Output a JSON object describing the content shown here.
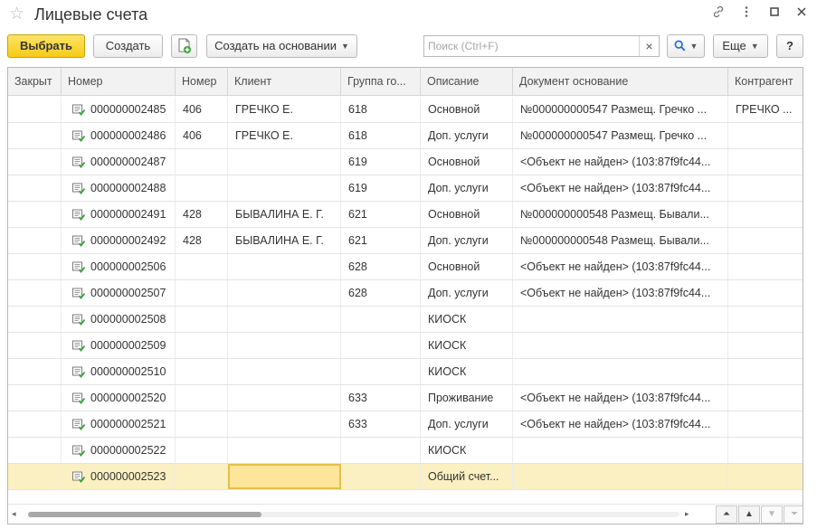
{
  "window": {
    "title": "Лицевые счета",
    "link_icon": "link-icon",
    "more_icon": "more-vertical-icon",
    "maximize_icon": "maximize-icon",
    "close_icon": "close-icon"
  },
  "toolbar": {
    "select_label": "Выбрать",
    "create_label": "Создать",
    "copy_icon": "copy-add-icon",
    "create_based_label": "Создать на основании",
    "search_placeholder": "Поиск (Ctrl+F)",
    "search_value": "",
    "clear_glyph": "×",
    "search_icon_glyph": "🔍",
    "more_label": "Еще",
    "help_label": "?"
  },
  "colors": {
    "primary_button": "#f5cc14",
    "selected_row": "#fbf0c2",
    "active_cell": "#fde59a",
    "icon_green": "#3aa33a"
  },
  "table": {
    "columns": [
      "Закрыт",
      "Номер",
      "Номер",
      "Клиент",
      "Группа го...",
      "Описание",
      "Документ основание",
      "Контрагент"
    ],
    "rows": [
      {
        "closed": "",
        "number": "000000002485",
        "num2": "406",
        "client": "ГРЕЧКО Е.",
        "group": "618",
        "description": "Основной",
        "document": "№000000000547 Размещ. Гречко ...",
        "counterparty": "ГРЕЧКО ..."
      },
      {
        "closed": "",
        "number": "000000002486",
        "num2": "406",
        "client": "ГРЕЧКО Е.",
        "group": "618",
        "description": "Доп. услуги",
        "document": "№000000000547 Размещ. Гречко ...",
        "counterparty": ""
      },
      {
        "closed": "",
        "number": "000000002487",
        "num2": "",
        "client": "",
        "group": "619",
        "description": "Основной",
        "document": "<Объект не найден> (103:87f9fc44...",
        "counterparty": ""
      },
      {
        "closed": "",
        "number": "000000002488",
        "num2": "",
        "client": "",
        "group": "619",
        "description": "Доп. услуги",
        "document": "<Объект не найден> (103:87f9fc44...",
        "counterparty": ""
      },
      {
        "closed": "",
        "number": "000000002491",
        "num2": "428",
        "client": "БЫВАЛИНА Е. Г.",
        "group": "621",
        "description": "Основной",
        "document": "№000000000548 Размещ. Бывали...",
        "counterparty": ""
      },
      {
        "closed": "",
        "number": "000000002492",
        "num2": "428",
        "client": "БЫВАЛИНА Е. Г.",
        "group": "621",
        "description": "Доп. услуги",
        "document": "№000000000548 Размещ. Бывали...",
        "counterparty": ""
      },
      {
        "closed": "",
        "number": "000000002506",
        "num2": "",
        "client": "",
        "group": "628",
        "description": "Основной",
        "document": "<Объект не найден> (103:87f9fc44...",
        "counterparty": ""
      },
      {
        "closed": "",
        "number": "000000002507",
        "num2": "",
        "client": "",
        "group": "628",
        "description": "Доп. услуги",
        "document": "<Объект не найден> (103:87f9fc44...",
        "counterparty": ""
      },
      {
        "closed": "",
        "number": "000000002508",
        "num2": "",
        "client": "",
        "group": "",
        "description": "КИОСК",
        "document": "",
        "counterparty": ""
      },
      {
        "closed": "",
        "number": "000000002509",
        "num2": "",
        "client": "",
        "group": "",
        "description": "КИОСК",
        "document": "",
        "counterparty": ""
      },
      {
        "closed": "",
        "number": "000000002510",
        "num2": "",
        "client": "",
        "group": "",
        "description": "КИОСК",
        "document": "",
        "counterparty": ""
      },
      {
        "closed": "",
        "number": "000000002520",
        "num2": "",
        "client": "",
        "group": "633",
        "description": "Проживание",
        "document": "<Объект не найден> (103:87f9fc44...",
        "counterparty": ""
      },
      {
        "closed": "",
        "number": "000000002521",
        "num2": "",
        "client": "",
        "group": "633",
        "description": "Доп. услуги",
        "document": "<Объект не найден> (103:87f9fc44...",
        "counterparty": ""
      },
      {
        "closed": "",
        "number": "000000002522",
        "num2": "",
        "client": "",
        "group": "",
        "description": "КИОСК",
        "document": "",
        "counterparty": ""
      },
      {
        "closed": "",
        "number": "000000002523",
        "num2": "",
        "client": "",
        "group": "",
        "description": "Общий счет...",
        "document": "",
        "counterparty": ""
      }
    ],
    "selected_row_index": 14
  },
  "footer": {
    "scroll_left_glyph": "◂",
    "scroll_right_glyph": "▸",
    "nav_first_glyph": "⏶",
    "nav_up_glyph": "▲",
    "nav_down_glyph": "▼",
    "nav_last_glyph": "⏷"
  }
}
